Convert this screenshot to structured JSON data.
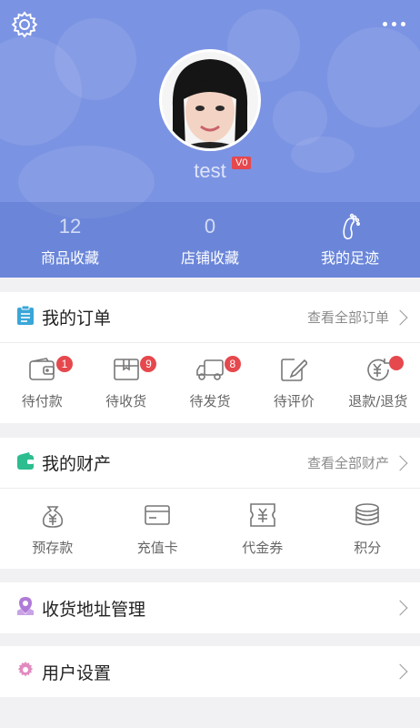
{
  "profile": {
    "username": "test",
    "level": "V0"
  },
  "stats": [
    {
      "value": "12",
      "label": "商品收藏"
    },
    {
      "value": "0",
      "label": "店铺收藏"
    },
    {
      "label": "我的足迹",
      "icon": "footprint-icon"
    }
  ],
  "orders": {
    "title": "我的订单",
    "link": "查看全部订单",
    "items": [
      {
        "label": "待付款",
        "icon": "wallet-icon",
        "badge": "1"
      },
      {
        "label": "待收货",
        "icon": "package-icon",
        "badge": "9"
      },
      {
        "label": "待发货",
        "icon": "truck-icon",
        "badge": "8"
      },
      {
        "label": "待评价",
        "icon": "edit-icon"
      },
      {
        "label": "退款/退货",
        "icon": "refund-icon",
        "badge_dot": true
      }
    ]
  },
  "assets": {
    "title": "我的财产",
    "link": "查看全部财产",
    "items": [
      {
        "label": "预存款",
        "icon": "money-bag-icon"
      },
      {
        "label": "充值卡",
        "icon": "card-icon"
      },
      {
        "label": "代金券",
        "icon": "voucher-icon"
      },
      {
        "label": "积分",
        "icon": "coins-icon"
      }
    ]
  },
  "address": {
    "title": "收货地址管理"
  },
  "settings": {
    "title": "用户设置"
  },
  "colors": {
    "header": "#7b93e3",
    "badge": "#e5484d",
    "orders_icon": "#3aa6d8",
    "assets_icon": "#2dbd8f",
    "address_icon": "#b07ad8",
    "settings_icon": "#e28ac0"
  }
}
